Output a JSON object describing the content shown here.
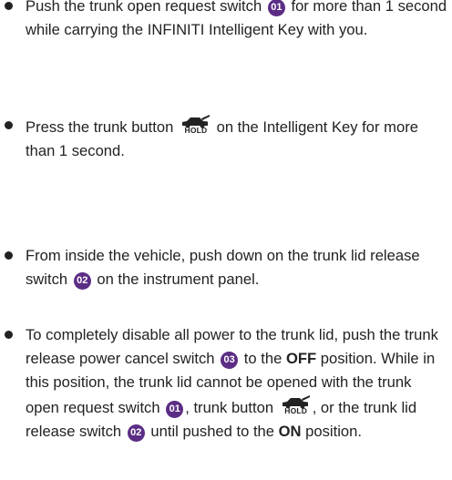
{
  "bullets": [
    {
      "segments": {
        "t1": "Push the trunk open request switch",
        "b1": "01",
        "t2": "for more than 1 second while carrying the INFINITI Intelligent Key with you."
      }
    },
    {
      "segments": {
        "t1": "Press the trunk button",
        "hold": "HOLD",
        "t2": "on the Intelligent Key for more than 1 second."
      }
    },
    {
      "segments": {
        "t1": "From inside the vehicle, push down on the trunk lid release switch",
        "b1": "02",
        "t2": "on the instrument panel."
      }
    },
    {
      "segments": {
        "t1": "To completely disable all power to the trunk lid, push the trunk release power cancel switch",
        "b1": "03",
        "t2": "to the",
        "off": "OFF",
        "t3": "position. While in this position, the trunk lid cannot be opened with the trunk open request switch",
        "b2": "01",
        "t4": ", trunk button",
        "hold": "HOLD",
        "t5": ", or the trunk lid release switch",
        "b3": "02",
        "t6": "until pushed to the",
        "on": "ON",
        "t7": "position."
      }
    }
  ],
  "colors": {
    "badge": "#5b2d84",
    "text": "#222222"
  },
  "icons": {
    "bullet": "bullet-dot",
    "trunk_button": "car-trunk-icon"
  }
}
